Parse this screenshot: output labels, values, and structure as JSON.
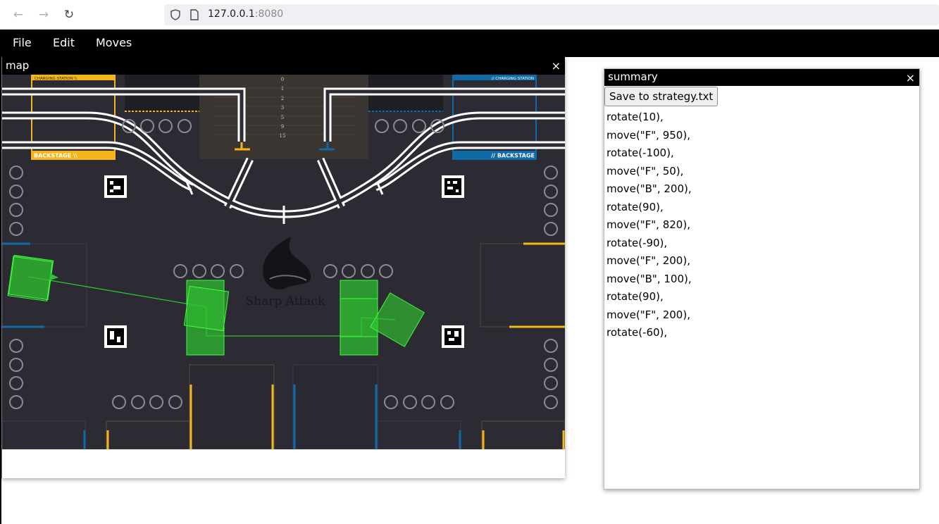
{
  "browser": {
    "url_host": "127.0.0.1",
    "url_port": ":8080"
  },
  "menu": {
    "items": [
      "File",
      "Edit",
      "Moves"
    ]
  },
  "map_window": {
    "title": "map",
    "close_label": "×",
    "board": {
      "charging_station_left": "CHARGING STATION \\\\",
      "charging_station_right": "// CHARGING STATION",
      "backstage_left": "BACKSTAGE \\\\",
      "backstage_right": "// BACKSTAGE",
      "ruler_marks": [
        "0",
        "1",
        "2",
        "3",
        "5",
        "9",
        "15"
      ],
      "logo_text": "Sharp Attack"
    },
    "colors": {
      "board": "#2c2a33",
      "yellow": "#f5b417",
      "blue": "#0f6aa8",
      "robot_fill": "#2fc42f",
      "robot_stroke": "#3cff3c"
    }
  },
  "summary_window": {
    "title": "summary",
    "close_label": "×",
    "save_button": "Save to strategy.txt",
    "moves": [
      "rotate(10),",
      "move(\"F\", 950),",
      "rotate(-100),",
      "move(\"F\", 50),",
      "move(\"B\", 200),",
      "rotate(90),",
      "move(\"F\", 820),",
      "rotate(-90),",
      "move(\"F\", 200),",
      "move(\"B\", 100),",
      "rotate(90),",
      "move(\"F\", 200),",
      "rotate(-60),"
    ]
  }
}
